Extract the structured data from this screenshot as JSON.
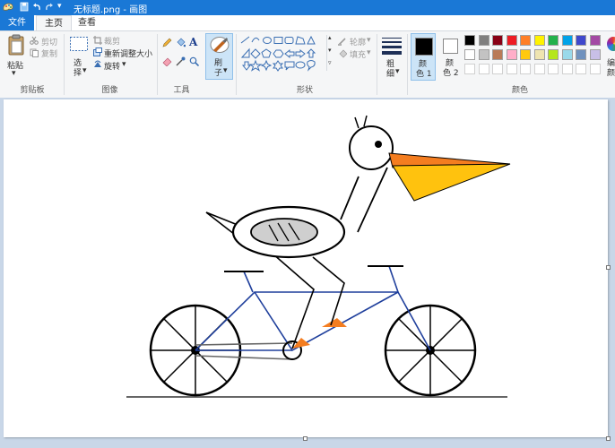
{
  "window": {
    "title": "无标题.png - 画图"
  },
  "tabs": {
    "file": "文件",
    "home": "主页",
    "view": "查看"
  },
  "clipboard": {
    "paste": "粘贴",
    "cut": "剪切",
    "copy": "复制",
    "group": "剪贴板"
  },
  "image": {
    "select": "选",
    "select2": "择",
    "crop": "裁剪",
    "resize": "重新调整大小",
    "rotate": "旋转",
    "group": "图像"
  },
  "tools": {
    "group": "工具"
  },
  "brushes": {
    "label": "刷",
    "label2": "子"
  },
  "shapes": {
    "outline": "轮廓",
    "fill": "填充",
    "group": "形状"
  },
  "size": {
    "label": "粗",
    "label2": "细"
  },
  "colors": {
    "color1_a": "颜",
    "color1_b": "色 1",
    "color2_a": "颜",
    "color2_b": "色 2",
    "group": "颜色",
    "edit_a": "编",
    "edit_b": "颜",
    "color1": "#000000",
    "color2": "#ffffff",
    "row1": [
      "#000000",
      "#7f7f7f",
      "#880015",
      "#ed1c24",
      "#ff7f27",
      "#fff200",
      "#22b14c",
      "#00a2e8",
      "#3f48cc",
      "#a349a4"
    ],
    "row2": [
      "#ffffff",
      "#c3c3c3",
      "#b97a57",
      "#ffaec9",
      "#ffc90e",
      "#efe4b0",
      "#b5e61d",
      "#99d9ea",
      "#7092be",
      "#c8bfe7"
    ],
    "row3": [
      "#ffffff",
      "#ffffff",
      "#ffffff",
      "#ffffff",
      "#ffffff",
      "#ffffff",
      "#ffffff",
      "#ffffff",
      "#ffffff",
      "#ffffff"
    ]
  },
  "drawing": {
    "beak_top": "#f47d20",
    "beak_bottom": "#ffc20e",
    "pedal": "#f47d20",
    "frame": "#1f3f9c",
    "body_fill": "#cfcfcf"
  }
}
